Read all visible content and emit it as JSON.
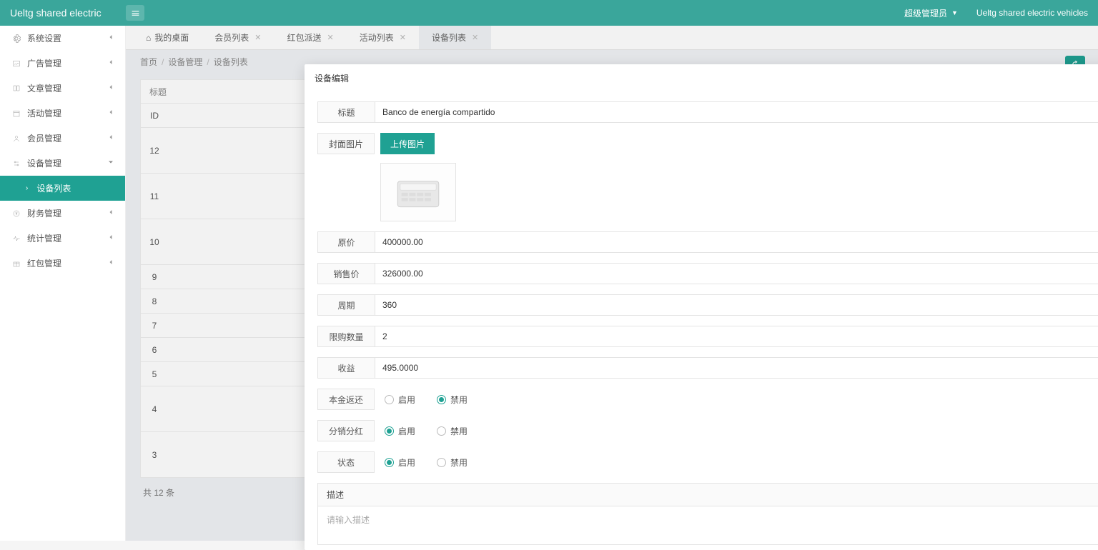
{
  "header": {
    "brand": "Ueltg shared electric",
    "user_role": "超级管理员",
    "right_text": "Ueltg shared electric vehicles"
  },
  "sidebar": {
    "items": [
      {
        "label": "系统设置"
      },
      {
        "label": "广告管理"
      },
      {
        "label": "文章管理"
      },
      {
        "label": "活动管理"
      },
      {
        "label": "会员管理"
      },
      {
        "label": "设备管理"
      },
      {
        "label": "财务管理"
      },
      {
        "label": "统计管理"
      },
      {
        "label": "红包管理"
      }
    ],
    "active_sub": "设备列表"
  },
  "tabs": [
    {
      "label": "我的桌面",
      "closable": false,
      "home": true
    },
    {
      "label": "会员列表",
      "closable": true
    },
    {
      "label": "红包派送",
      "closable": true
    },
    {
      "label": "活动列表",
      "closable": true
    },
    {
      "label": "设备列表",
      "closable": true,
      "active": true
    }
  ],
  "breadcrumb": {
    "a": "首页",
    "b": "设备管理",
    "c": "设备列表"
  },
  "bg": {
    "title_label": "标题",
    "id_label": "ID",
    "ids": [
      "12",
      "11",
      "10",
      "9",
      "8",
      "7",
      "6",
      "5",
      "4",
      "3"
    ],
    "footer": "共 12 条"
  },
  "modal": {
    "title": "设备编辑",
    "labels": {
      "title": "标题",
      "cover": "封面图片",
      "upload": "上传图片",
      "orig_price": "原价",
      "sale_price": "销售价",
      "period": "周期",
      "limit_qty": "限购数量",
      "income": "收益",
      "principal_return": "本金返还",
      "dist_dividend": "分销分红",
      "status": "状态",
      "desc": "描述",
      "desc_ph": "请输入描述",
      "enable": "启用",
      "disable": "禁用"
    },
    "values": {
      "title": "Banco de energía compartido",
      "orig_price": "400000.00",
      "sale_price": "326000.00",
      "period": "360",
      "limit_qty": "2",
      "income": "495.0000",
      "principal_return": "disable",
      "dist_dividend": "enable",
      "status": "enable"
    }
  }
}
